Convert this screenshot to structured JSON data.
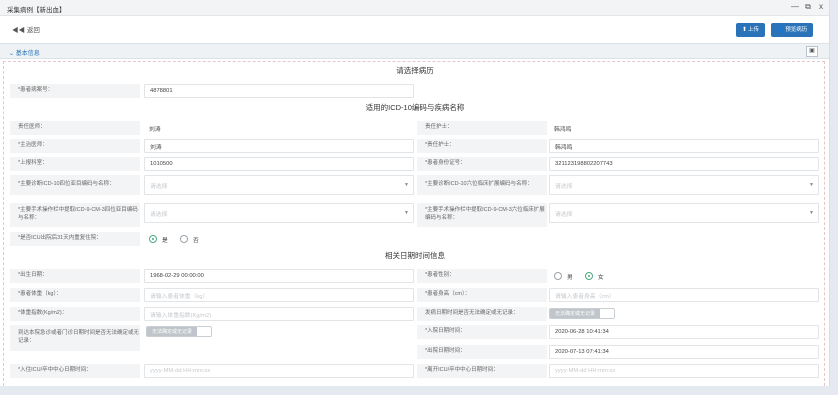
{
  "window": {
    "title": "采集病例【新出血】",
    "minimize": "—",
    "restore": "⧉",
    "close": "x"
  },
  "toolbar": {
    "back_label": "返回",
    "upload_label": "上传",
    "preview_label": "预览病历"
  },
  "section": {
    "label": "基本信息"
  },
  "groups": {
    "select_record": "请选择病历",
    "icd10": "适用的ICD-10编码与疾病名称",
    "dates": "相关日期时间信息"
  },
  "fields": {
    "record_no": {
      "label": "*患者病案号：",
      "value": "4878801"
    },
    "attending": {
      "label": "责任医师：",
      "value": "刘涛"
    },
    "nurse_in_charge": {
      "label": "责任护士：",
      "value": "韩鸿鸣"
    },
    "chief_doctor": {
      "label": "*主治医师：",
      "value": "刘涛"
    },
    "nurse": {
      "label": "*责任护士：",
      "value": "韩鸿鸣"
    },
    "dept": {
      "label": "*上报科室：",
      "value": "1010500"
    },
    "id_no": {
      "label": "*患者身份证号：",
      "value": "321123198802207743"
    },
    "main_diag": {
      "label": "*主要诊断ICD-10四位亚目编码与名称：",
      "placeholder": "请选择"
    },
    "main_diag_ext": {
      "label": "*主要诊断ICD-10六位临床扩展编码与名称：",
      "placeholder": "请选择"
    },
    "main_op": {
      "label": "*主要手术操作栏中提取ICD-9-CM-3四位亚目编码与名称：",
      "placeholder": "请选择"
    },
    "main_op_ext": {
      "label": "*主要手术操作栏中提取ICD-9-CM-3六位临床扩展编码与名称：",
      "placeholder": "请选择"
    },
    "readmit": {
      "label": "*是否ICU出院后31天内重复住院：",
      "options": [
        "是",
        "否"
      ],
      "selected": "是"
    },
    "birth": {
      "label": "*出生日期：",
      "value": "1968-02-29 00:00:00"
    },
    "gender": {
      "label": "*患者性别：",
      "options": [
        "男",
        "女"
      ],
      "selected": "女"
    },
    "weight": {
      "label": "*患者体重（kg）：",
      "placeholder": "请输入患者体重（kg）"
    },
    "height": {
      "label": "*患者身高（cm）：",
      "placeholder": "请输入患者身高（cm）"
    },
    "bmi": {
      "label": "*体重指数(Kg/m2)：",
      "placeholder": "请输入体重指数(Kg/m2)"
    },
    "onset_time": {
      "label": "发病日期时间是否无法确定或无记录：",
      "toggle": "无法确定或无记录"
    },
    "arrive_time": {
      "label": "到达本院急诊或者门诊日期时间是否无法确定或无记录：",
      "toggle": "无法确定或无记录"
    },
    "admit_time": {
      "label": "*入院日期时间：",
      "value": "2020-06-28 10:41:34"
    },
    "discharge_time": {
      "label": "*出院日期时间：",
      "value": "2020-07-13 07:41:34"
    },
    "icu_in": {
      "label": "*入住ICU/卒中中心日期时间：",
      "placeholder": "yyyy-MM-dd HH:mm:ss"
    },
    "icu_out": {
      "label": "*离开ICU/卒中中心日期时间：",
      "placeholder": "yyyy-MM-dd HH:mm:ss"
    }
  },
  "colors": {
    "primary": "#2a73b8",
    "radio_selected": "#4aa87e",
    "label_bg": "#f3f4f6"
  }
}
